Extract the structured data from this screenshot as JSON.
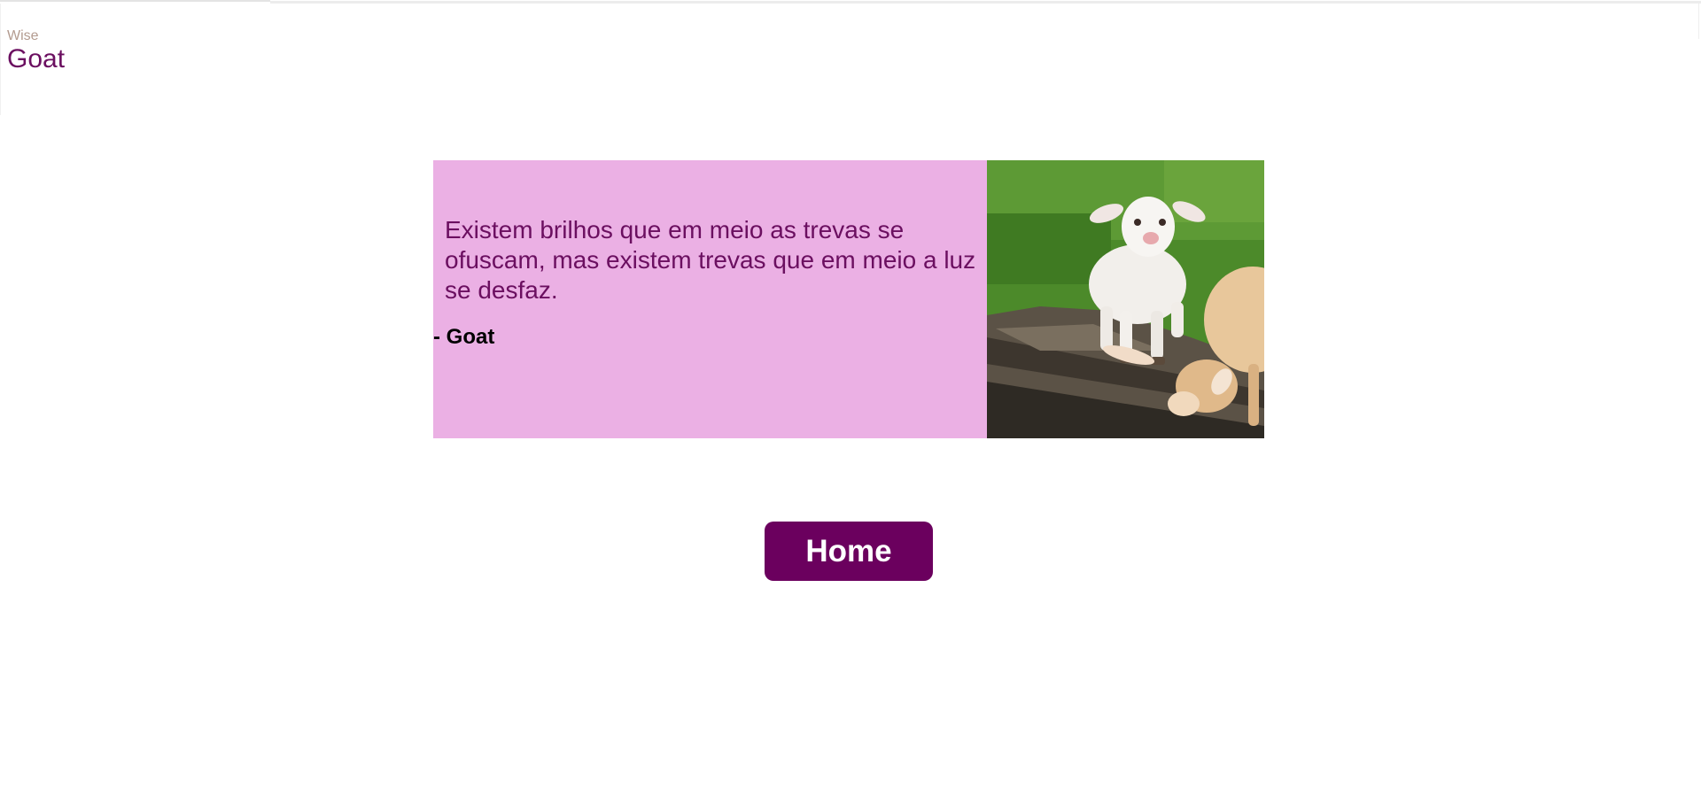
{
  "brand": {
    "small": "Wise",
    "big": "Goat"
  },
  "quote": {
    "text": "Existem brilhos que em meio as trevas se ofuscam, mas existem trevas que em meio a luz se desfaz.",
    "author": "- Goat"
  },
  "photo": {
    "description": "two baby goats on a log in grass"
  },
  "buttons": {
    "home_label": "Home"
  },
  "colors": {
    "accent": "#6b0f60",
    "panel": "#ebb0e4",
    "button": "#6b005e"
  }
}
